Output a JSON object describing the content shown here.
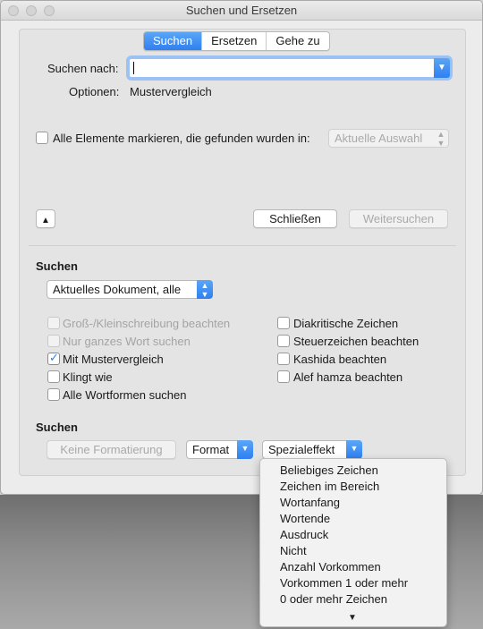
{
  "window": {
    "title": "Suchen und Ersetzen"
  },
  "tabs": [
    {
      "label": "Suchen",
      "active": true
    },
    {
      "label": "Ersetzen",
      "active": false
    },
    {
      "label": "Gehe zu",
      "active": false
    }
  ],
  "search": {
    "label": "Suchen nach:",
    "value": ""
  },
  "options": {
    "label": "Optionen:",
    "value": "Mustervergleich"
  },
  "highlight": {
    "label": "Alle Elemente markieren, die gefunden wurden in:",
    "checked": false,
    "dropdown_value": "Aktuelle Auswahl"
  },
  "buttons": {
    "close": "Schließen",
    "find_next": "Weitersuchen"
  },
  "scope": {
    "heading": "Suchen",
    "dropdown_value": "Aktuelles Dokument, alle"
  },
  "checkboxes_left": [
    {
      "label": "Groß-/Kleinschreibung beachten",
      "checked": false,
      "disabled": true
    },
    {
      "label": "Nur ganzes Wort suchen",
      "checked": false,
      "disabled": true
    },
    {
      "label": "Mit Mustervergleich",
      "checked": true,
      "disabled": false
    },
    {
      "label": "Klingt wie",
      "checked": false,
      "disabled": false
    },
    {
      "label": "Alle Wortformen suchen",
      "checked": false,
      "disabled": false
    }
  ],
  "checkboxes_right": [
    {
      "label": "Diakritische Zeichen",
      "checked": false
    },
    {
      "label": "Steuerzeichen beachten",
      "checked": false
    },
    {
      "label": "Kashida beachten",
      "checked": false
    },
    {
      "label": "Alef hamza beachten",
      "checked": false
    }
  ],
  "format_section": {
    "heading": "Suchen",
    "no_formatting": "Keine Formatierung",
    "format": "Format",
    "special": "Spezialeffekt"
  },
  "special_menu": {
    "items": [
      "Beliebiges Zeichen",
      "Zeichen im Bereich",
      "Wortanfang",
      "Wortende",
      "Ausdruck",
      "Nicht",
      "Anzahl Vorkommen",
      "Vorkommen 1 oder mehr",
      "0 oder mehr Zeichen"
    ],
    "more_indicator": "▼"
  },
  "colors": {
    "accent": "#2f7ff0",
    "window_bg": "#ececec"
  }
}
